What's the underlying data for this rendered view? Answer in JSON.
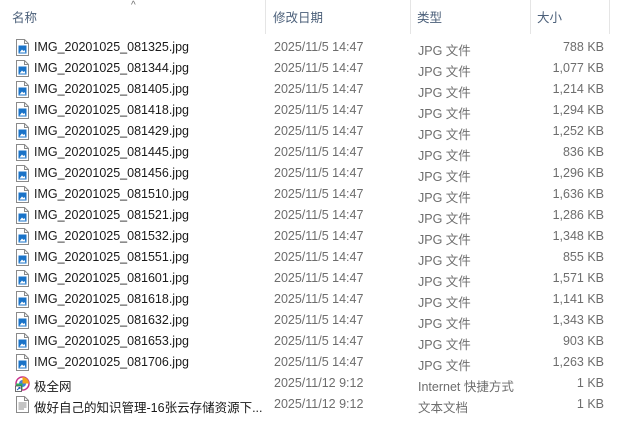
{
  "columns": {
    "name": "名称",
    "date": "修改日期",
    "type": "类型",
    "size": "大小"
  },
  "files": [
    {
      "name": "IMG_20201025_081325.jpg",
      "date": "2025/11/5 14:47",
      "type": "JPG 文件",
      "size": "788 KB",
      "icon": "image-file-icon"
    },
    {
      "name": "IMG_20201025_081344.jpg",
      "date": "2025/11/5 14:47",
      "type": "JPG 文件",
      "size": "1,077 KB",
      "icon": "image-file-icon"
    },
    {
      "name": "IMG_20201025_081405.jpg",
      "date": "2025/11/5 14:47",
      "type": "JPG 文件",
      "size": "1,214 KB",
      "icon": "image-file-icon"
    },
    {
      "name": "IMG_20201025_081418.jpg",
      "date": "2025/11/5 14:47",
      "type": "JPG 文件",
      "size": "1,294 KB",
      "icon": "image-file-icon"
    },
    {
      "name": "IMG_20201025_081429.jpg",
      "date": "2025/11/5 14:47",
      "type": "JPG 文件",
      "size": "1,252 KB",
      "icon": "image-file-icon"
    },
    {
      "name": "IMG_20201025_081445.jpg",
      "date": "2025/11/5 14:47",
      "type": "JPG 文件",
      "size": "836 KB",
      "icon": "image-file-icon"
    },
    {
      "name": "IMG_20201025_081456.jpg",
      "date": "2025/11/5 14:47",
      "type": "JPG 文件",
      "size": "1,296 KB",
      "icon": "image-file-icon"
    },
    {
      "name": "IMG_20201025_081510.jpg",
      "date": "2025/11/5 14:47",
      "type": "JPG 文件",
      "size": "1,636 KB",
      "icon": "image-file-icon"
    },
    {
      "name": "IMG_20201025_081521.jpg",
      "date": "2025/11/5 14:47",
      "type": "JPG 文件",
      "size": "1,286 KB",
      "icon": "image-file-icon"
    },
    {
      "name": "IMG_20201025_081532.jpg",
      "date": "2025/11/5 14:47",
      "type": "JPG 文件",
      "size": "1,348 KB",
      "icon": "image-file-icon"
    },
    {
      "name": "IMG_20201025_081551.jpg",
      "date": "2025/11/5 14:47",
      "type": "JPG 文件",
      "size": "855 KB",
      "icon": "image-file-icon"
    },
    {
      "name": "IMG_20201025_081601.jpg",
      "date": "2025/11/5 14:47",
      "type": "JPG 文件",
      "size": "1,571 KB",
      "icon": "image-file-icon"
    },
    {
      "name": "IMG_20201025_081618.jpg",
      "date": "2025/11/5 14:47",
      "type": "JPG 文件",
      "size": "1,141 KB",
      "icon": "image-file-icon"
    },
    {
      "name": "IMG_20201025_081632.jpg",
      "date": "2025/11/5 14:47",
      "type": "JPG 文件",
      "size": "1,343 KB",
      "icon": "image-file-icon"
    },
    {
      "name": "IMG_20201025_081653.jpg",
      "date": "2025/11/5 14:47",
      "type": "JPG 文件",
      "size": "903 KB",
      "icon": "image-file-icon"
    },
    {
      "name": "IMG_20201025_081706.jpg",
      "date": "2025/11/5 14:47",
      "type": "JPG 文件",
      "size": "1,263 KB",
      "icon": "image-file-icon"
    },
    {
      "name": "极全网",
      "date": "2025/11/12 9:12",
      "type": "Internet 快捷方式",
      "size": "1 KB",
      "icon": "internet-shortcut-icon"
    },
    {
      "name": "做好自己的知识管理-16张云存储资源下...",
      "date": "2025/11/12 9:12",
      "type": "文本文档",
      "size": "1 KB",
      "icon": "text-document-icon"
    }
  ],
  "colors": {
    "header_text": "#4c607a",
    "secondary_text": "#6d6d6d",
    "image_icon_blue": "#1a73c8"
  }
}
